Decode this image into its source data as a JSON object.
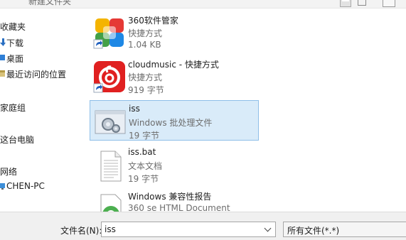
{
  "window": {
    "title": "新建文件夹"
  },
  "sidebar": {
    "items": [
      {
        "label": "收藏夹"
      },
      {
        "label": "下载"
      },
      {
        "label": "桌面"
      },
      {
        "label": "最近访问的位置"
      },
      {
        "label": "家庭组"
      },
      {
        "label": "这台电脑"
      },
      {
        "label": "网络"
      },
      {
        "label": "CHEN-PC"
      }
    ]
  },
  "files": [
    {
      "name": "360软件管家",
      "type": "快捷方式",
      "size": "1.04 KB",
      "icon": "360-software-manager-icon"
    },
    {
      "name": "cloudmusic - 快捷方式",
      "type": "快捷方式",
      "size": "919 字节",
      "icon": "cloudmusic-icon"
    },
    {
      "name": "iss",
      "type": "Windows 批处理文件",
      "size": "19 字节",
      "icon": "batch-file-gear-icon",
      "selected": true
    },
    {
      "name": "iss.bat",
      "type": "文本文档",
      "size": "19 字节",
      "icon": "text-document-icon"
    },
    {
      "name": "Windows 兼容性报告",
      "type": "360 se HTML Document",
      "size": "",
      "icon": "html-document-icon"
    }
  ],
  "footer": {
    "filename_label": "文件名(N):",
    "filename_value": "iss",
    "filetype_value": "所有文件(*.*)"
  },
  "colors": {
    "selection_bg": "#d9ebf9",
    "selection_border": "#8fbfe8"
  }
}
